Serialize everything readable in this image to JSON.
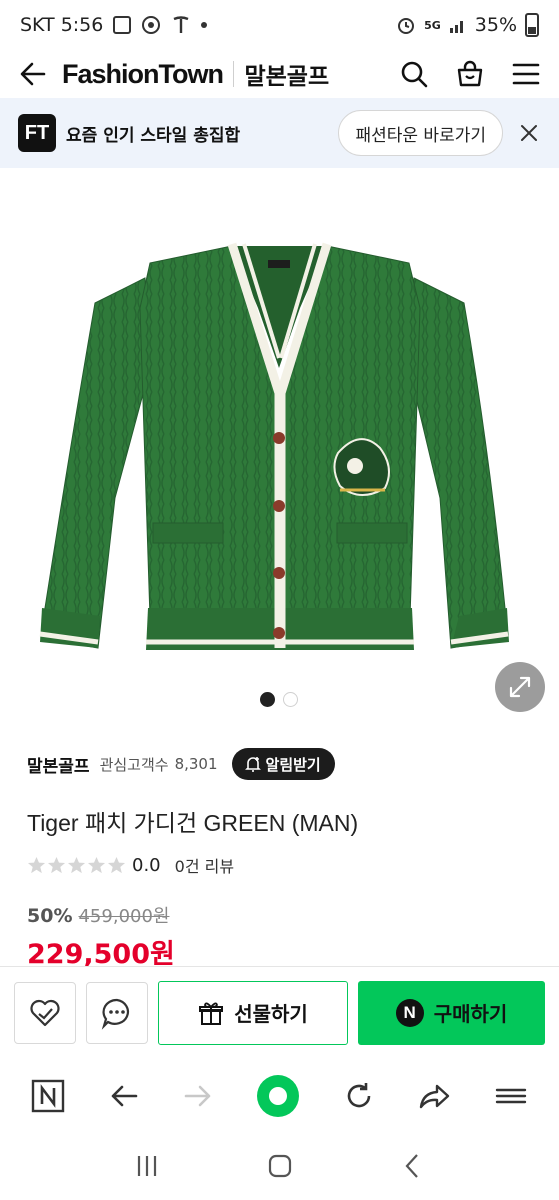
{
  "status_bar": {
    "carrier_time": "SKT 5:56",
    "network": "5G",
    "battery": "35%"
  },
  "header": {
    "brand": "FashionTown",
    "store": "말본골프",
    "icons": [
      "back-arrow-icon",
      "search-icon",
      "shopping-bag-icon",
      "menu-icon"
    ]
  },
  "banner": {
    "logo": "FT",
    "text": "요즘 인기 스타일 총집합",
    "button": "패션타운 바로가기"
  },
  "product": {
    "store_name": "말본골프",
    "favorite_label": "관심고객수",
    "favorite_count": "8,301",
    "alarm_button": "알림받기",
    "title": "Tiger 패치 가디건 GREEN (MAN)",
    "rating": "0.0",
    "review": "0건 리뷰",
    "discount": "50%",
    "original_price": "459,000원",
    "price": "229,500원",
    "image": {
      "color": "#2f7a3a",
      "trim": "#f3f1e6",
      "carousel_count": 2,
      "carousel_active": 1
    }
  },
  "actions": {
    "gift": "선물하기",
    "buy": "구매하기",
    "buy_color": "#03c75a"
  },
  "browser": {
    "icons": [
      "naver-n-icon",
      "back-icon",
      "forward-icon",
      "home-circle-icon",
      "refresh-icon",
      "share-icon",
      "menu-icon"
    ]
  },
  "system_nav": {
    "icons": [
      "recents-icon",
      "home-icon",
      "back-icon"
    ]
  }
}
